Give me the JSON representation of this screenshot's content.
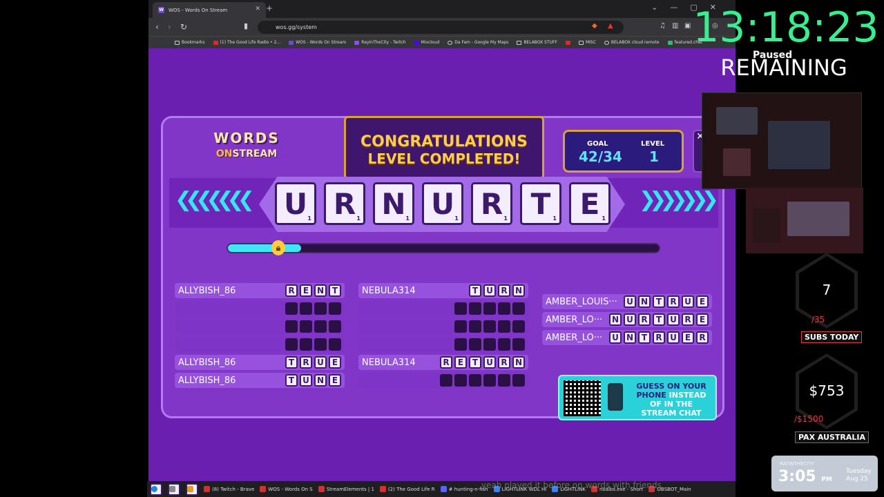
{
  "browser": {
    "tab_title": "WOS - Words On Stream",
    "tab_favicon": "W",
    "url": "wos.gg/system",
    "bookmarks": [
      "Bookmarks",
      "(1) The Good Life Radio • 2...",
      "WOS - Words On Stream",
      "RayInTheCity - Twitch",
      "Mixcloud",
      "Da Fam - Google My Maps",
      "BELABOX STUFF",
      "MISC",
      "BELABOX cloud remote",
      "featured.chat"
    ]
  },
  "game": {
    "logo_line1": "WORDS",
    "logo_on": "ON",
    "logo_stream": "STREAM",
    "congrats_line1": "CONGRATULATIONS",
    "congrats_line2": "LEVEL COMPLETED!",
    "goal_label": "GOAL",
    "goal_value": "42/34",
    "level_label": "LEVEL",
    "level_value": "1",
    "letters": [
      "U",
      "R",
      "N",
      "U",
      "R",
      "T",
      "E"
    ],
    "letter_score": "1",
    "progress_fraction": 0.17,
    "col1": [
      {
        "name": "ALLYBISH_86",
        "letters": [
          "R",
          "E",
          "N",
          "T"
        ]
      },
      {
        "name": "",
        "letters": [
          "",
          "",
          "",
          ""
        ]
      },
      {
        "name": "",
        "letters": [
          "",
          "",
          "",
          ""
        ]
      },
      {
        "name": "",
        "letters": [
          "",
          "",
          "",
          ""
        ]
      },
      {
        "name": "ALLYBISH_86",
        "letters": [
          "T",
          "R",
          "U",
          "E"
        ]
      },
      {
        "name": "ALLYBISH_86",
        "letters": [
          "T",
          "U",
          "N",
          "E"
        ]
      }
    ],
    "col2": [
      {
        "name": "NEBULA314",
        "letters": [
          "T",
          "U",
          "R",
          "N"
        ]
      },
      {
        "name": "",
        "letters": [
          "",
          "",
          "",
          "",
          ""
        ]
      },
      {
        "name": "",
        "letters": [
          "",
          "",
          "",
          "",
          ""
        ]
      },
      {
        "name": "",
        "letters": [
          "",
          "",
          "",
          "",
          ""
        ]
      },
      {
        "name": "NEBULA314",
        "letters": [
          "R",
          "E",
          "T",
          "U",
          "R",
          "N"
        ]
      },
      {
        "name": "",
        "letters": [
          "",
          "",
          "",
          "",
          "",
          ""
        ]
      }
    ],
    "col3": [
      {
        "name": "AMBER_LOUIS···",
        "letters": [
          "U",
          "N",
          "T",
          "R",
          "U",
          "E"
        ]
      },
      {
        "name": "AMBER_LO···",
        "letters": [
          "N",
          "U",
          "R",
          "T",
          "U",
          "R",
          "E"
        ]
      },
      {
        "name": "AMBER_LO···",
        "letters": [
          "U",
          "N",
          "T",
          "R",
          "U",
          "E",
          "R"
        ]
      }
    ],
    "qr_line1": "GUESS ON YOUR",
    "qr_line2a": "PHONE",
    "qr_line2b": "INSTEAD",
    "qr_line3": "OF IN THE",
    "qr_line4": "STREAM CHAT"
  },
  "overlay": {
    "timer": "13:18:23",
    "paused": "Paused",
    "remaining": "REMAINING",
    "subs_value": "7",
    "subs_goal": "/35",
    "subs_label": "SUBS TODAY",
    "money_value": "$753",
    "money_goal": "/$1500",
    "money_label": "PAX AUSTRALIA",
    "clock_user": "RAYINTHECITY",
    "clock_time": "3:05",
    "clock_ampm": "PM",
    "clock_day": "Tuesday",
    "clock_date": "Aug 25",
    "chat_overlay": "yeah played it before on words with friends"
  },
  "taskbar": [
    "(8) Twitch - Brave",
    "WOS - Words On S",
    "StreamElements | 1",
    "(2) The Good Life R",
    "# hunting-n-fish",
    "LIGHTLINK WDL Hi",
    "LIGHTLINK",
    "noalbs.exe - Short",
    "OBSBOT_Main"
  ]
}
